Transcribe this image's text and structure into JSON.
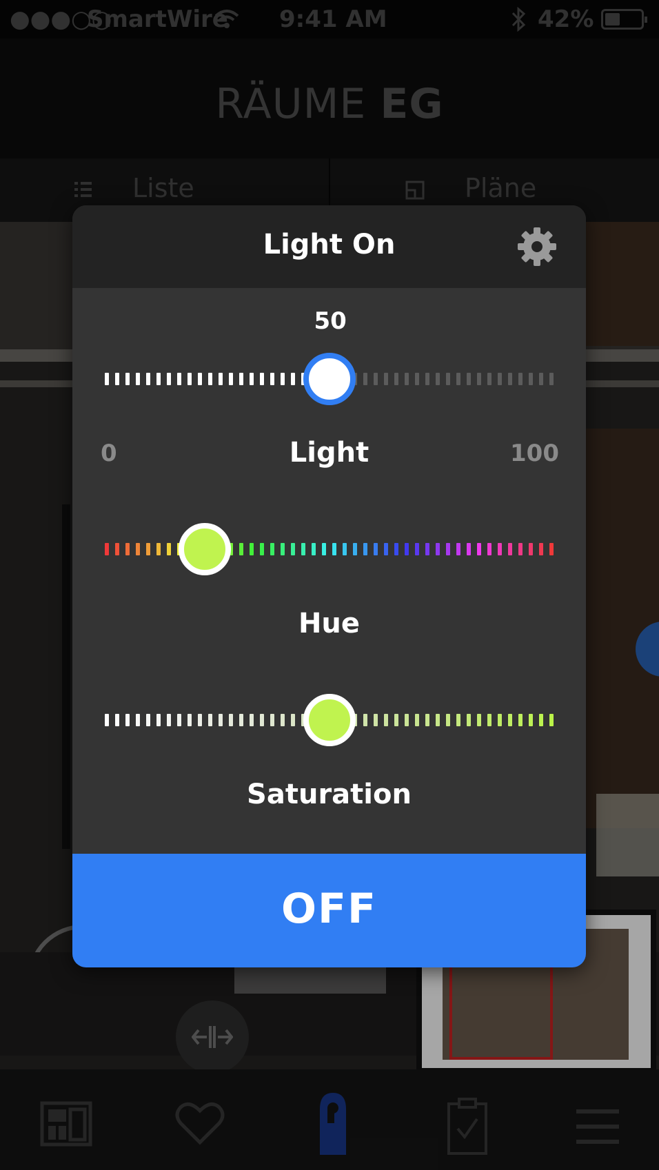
{
  "status_bar": {
    "signal_dots": "●●●○○",
    "carrier": "SmartWire",
    "time": "9:41 AM",
    "battery_percent": "42%",
    "battery_level": 0.42
  },
  "header": {
    "title_light": "RÄUME",
    "title_bold": "EG"
  },
  "view_tabs": [
    {
      "label": "Liste",
      "icon": "list-icon"
    },
    {
      "label": "Pläne",
      "icon": "plan-icon"
    }
  ],
  "modal": {
    "title": "Light On",
    "settings_icon": "gear-icon",
    "light": {
      "label": "Light",
      "value": 50,
      "value_text": "50",
      "min": "0",
      "max": "100"
    },
    "hue": {
      "label": "Hue",
      "position": 0.22,
      "knob_color": "#c0f34f"
    },
    "saturation": {
      "label": "Saturation",
      "position": 0.5,
      "knob_color": "#c0f34f"
    },
    "off_label": "OFF"
  },
  "tab_bar": [
    {
      "icon": "dashboard-icon",
      "active": false
    },
    {
      "icon": "heart-icon",
      "active": false
    },
    {
      "icon": "door-hanger-icon",
      "active": true
    },
    {
      "icon": "clipboard-check-icon",
      "active": false
    },
    {
      "icon": "menu-icon",
      "active": false
    }
  ],
  "colors": {
    "accent": "#317ef3",
    "knob_ring": "#317ef3",
    "inactive_tick": "#5c5c5c",
    "modal_bg": "#343434",
    "modal_header": "#232323"
  }
}
